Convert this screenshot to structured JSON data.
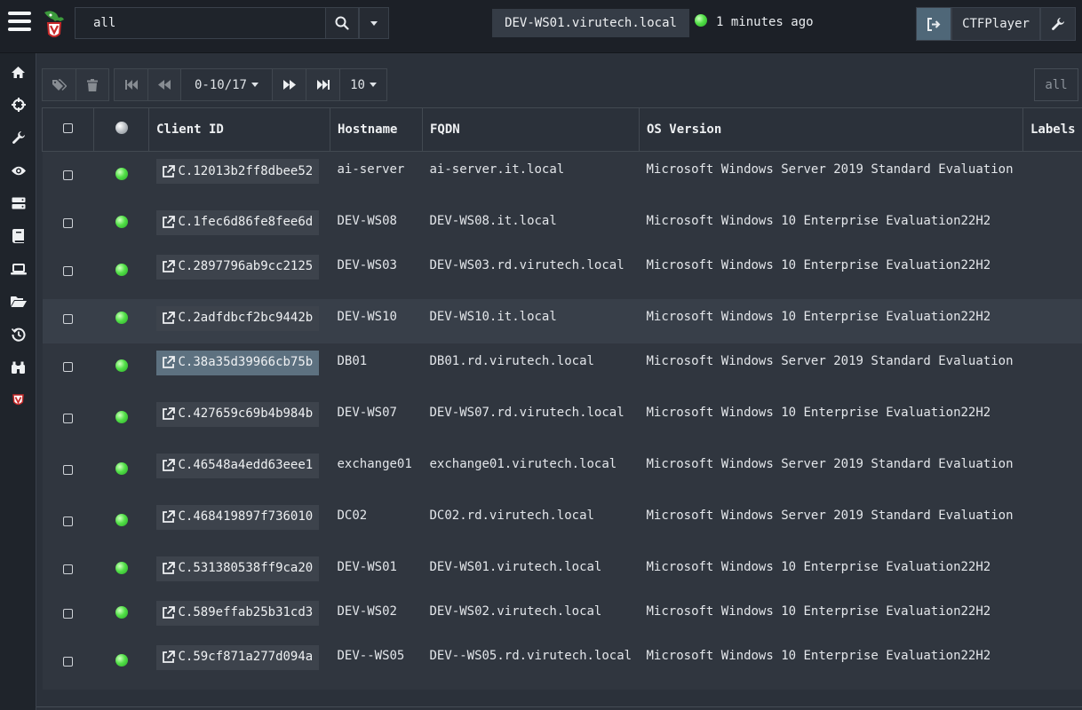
{
  "search": {
    "value": "all"
  },
  "header": {
    "hostname": "DEV-WS01.virutech.local",
    "last_seen": "1 minutes ago",
    "username": "CTFPlayer"
  },
  "toolbar": {
    "page_range": "0-10/17",
    "page_size": "10",
    "filter_value": "all"
  },
  "table": {
    "columns": {
      "client_id": "Client ID",
      "hostname": "Hostname",
      "fqdn": "FQDN",
      "os": "OS Version",
      "labels": "Labels"
    },
    "rows": [
      {
        "client_id": "C.12013b2ff8dbee52",
        "hostname": "ai-server",
        "fqdn": "ai-server.it.local",
        "os": "Microsoft Windows Server 2019 Standard Evaluation"
      },
      {
        "client_id": "C.1fec6d86fe8fee6d",
        "hostname": "DEV-WS08",
        "fqdn": "DEV-WS08.it.local",
        "os": "Microsoft Windows 10 Enterprise Evaluation22H2"
      },
      {
        "client_id": "C.2897796ab9cc2125",
        "hostname": "DEV-WS03",
        "fqdn": "DEV-WS03.rd.virutech.local",
        "os": "Microsoft Windows 10 Enterprise Evaluation22H2"
      },
      {
        "client_id": "C.2adfdbcf2bc9442b",
        "hostname": "DEV-WS10",
        "fqdn": "DEV-WS10.it.local",
        "os": "Microsoft Windows 10 Enterprise Evaluation22H2"
      },
      {
        "client_id": "C.38a35d39966cb75b",
        "hostname": "DB01",
        "fqdn": "DB01.rd.virutech.local",
        "os": "Microsoft Windows Server 2019 Standard Evaluation"
      },
      {
        "client_id": "C.427659c69b4b984b",
        "hostname": "DEV-WS07",
        "fqdn": "DEV-WS07.rd.virutech.local",
        "os": "Microsoft Windows 10 Enterprise Evaluation22H2"
      },
      {
        "client_id": "C.46548a4edd63eee1",
        "hostname": "exchange01",
        "fqdn": "exchange01.virutech.local",
        "os": "Microsoft Windows Server 2019 Standard Evaluation"
      },
      {
        "client_id": "C.468419897f736010",
        "hostname": "DC02",
        "fqdn": "DC02.rd.virutech.local",
        "os": "Microsoft Windows Server 2019 Standard Evaluation"
      },
      {
        "client_id": "C.531380538ff9ca20",
        "hostname": "DEV-WS01",
        "fqdn": "DEV-WS01.virutech.local",
        "os": "Microsoft Windows 10 Enterprise Evaluation22H2"
      },
      {
        "client_id": "C.589effab25b31cd3",
        "hostname": "DEV-WS02",
        "fqdn": "DEV-WS02.virutech.local",
        "os": "Microsoft Windows 10 Enterprise Evaluation22H2"
      },
      {
        "client_id": "C.59cf871a277d094a",
        "hostname": "DEV--WS05",
        "fqdn": "DEV--WS05.rd.virutech.local",
        "os": "Microsoft Windows 10 Enterprise Evaluation22H2"
      }
    ]
  },
  "sidebar": {
    "items": [
      "home-icon",
      "crosshairs-icon",
      "wrench-icon",
      "eye-icon",
      "server-icon",
      "book-icon",
      "laptop-icon",
      "folder-open-icon",
      "history-icon",
      "binoculars-icon",
      "velociraptor-icon"
    ]
  },
  "colors": {
    "online": "#52e047",
    "accent": "#4f6778",
    "selected_client": "#5d7180"
  }
}
